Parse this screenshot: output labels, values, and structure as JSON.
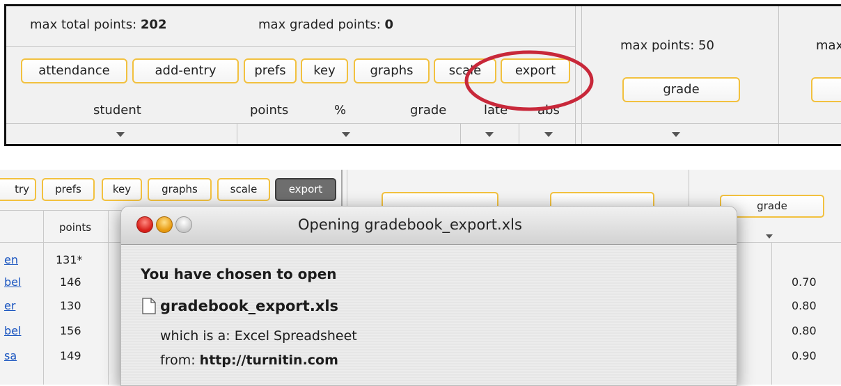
{
  "top": {
    "max_total_label": "max total points:",
    "max_total_value": "202",
    "max_graded_label": "max graded points:",
    "max_graded_value": "0",
    "buttons": [
      "attendance",
      "add-entry",
      "prefs",
      "key",
      "graphs",
      "scale",
      "export"
    ],
    "columns": [
      "student",
      "points",
      "%",
      "grade",
      "late",
      "abs"
    ],
    "assignment_max_label": "max points: 50",
    "assignment_grade_button": "grade",
    "next_assignment_label": "max"
  },
  "bottom": {
    "buttons": [
      "try",
      "prefs",
      "key",
      "graphs",
      "scale",
      "export"
    ],
    "points_header": "points",
    "grade_button": "grade",
    "rows": [
      {
        "name": "en",
        "points": "131*",
        "value": ""
      },
      {
        "name": "bel",
        "points": "146",
        "value": "0.70"
      },
      {
        "name": "er",
        "points": "130",
        "value": "0.80"
      },
      {
        "name": "bel",
        "points": "156",
        "value": "0.80"
      },
      {
        "name": "sa",
        "points": "149",
        "value": "0.90"
      }
    ]
  },
  "dialog": {
    "title": "Opening gradebook_export.xls",
    "heading": "You have chosen to open",
    "filename": "gradebook_export.xls",
    "type_line": "which is a: Excel Spreadsheet",
    "from_label": "from:",
    "from_value": "http://turnitin.com"
  },
  "colors": {
    "button_border": "#f2c13f",
    "highlight_circle": "#c8283a",
    "export_active_bg": "#6e6e6e",
    "link": "#1a55c0"
  }
}
